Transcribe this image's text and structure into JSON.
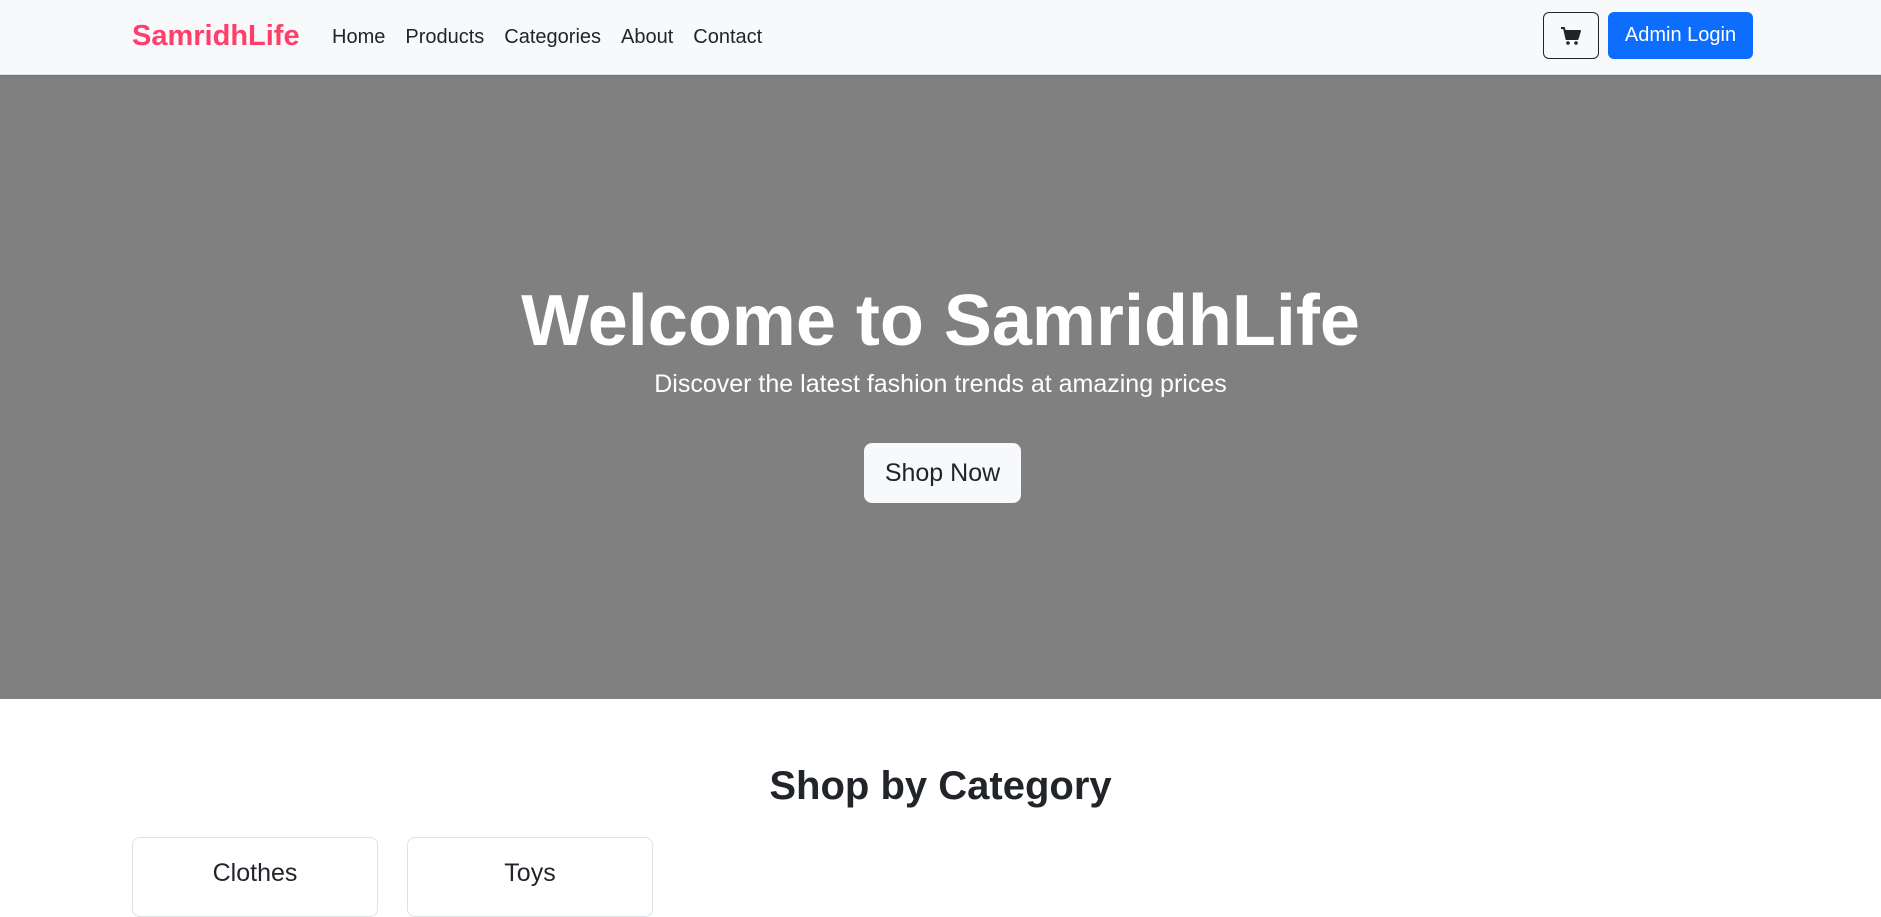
{
  "navbar": {
    "brand": "SamridhLife",
    "brand_color": "#ff3e6c",
    "links": [
      "Home",
      "Products",
      "Categories",
      "About",
      "Contact"
    ],
    "cart_icon": "cart-icon",
    "admin_login_label": "Admin Login",
    "admin_button_color": "#0d6efd"
  },
  "hero": {
    "title": "Welcome to SamridhLife",
    "subtitle": "Discover the latest fashion trends at amazing prices",
    "cta_label": "Shop Now",
    "background_color": "#808080"
  },
  "categories": {
    "title": "Shop by Category",
    "items": [
      "Clothes",
      "Toys"
    ]
  }
}
